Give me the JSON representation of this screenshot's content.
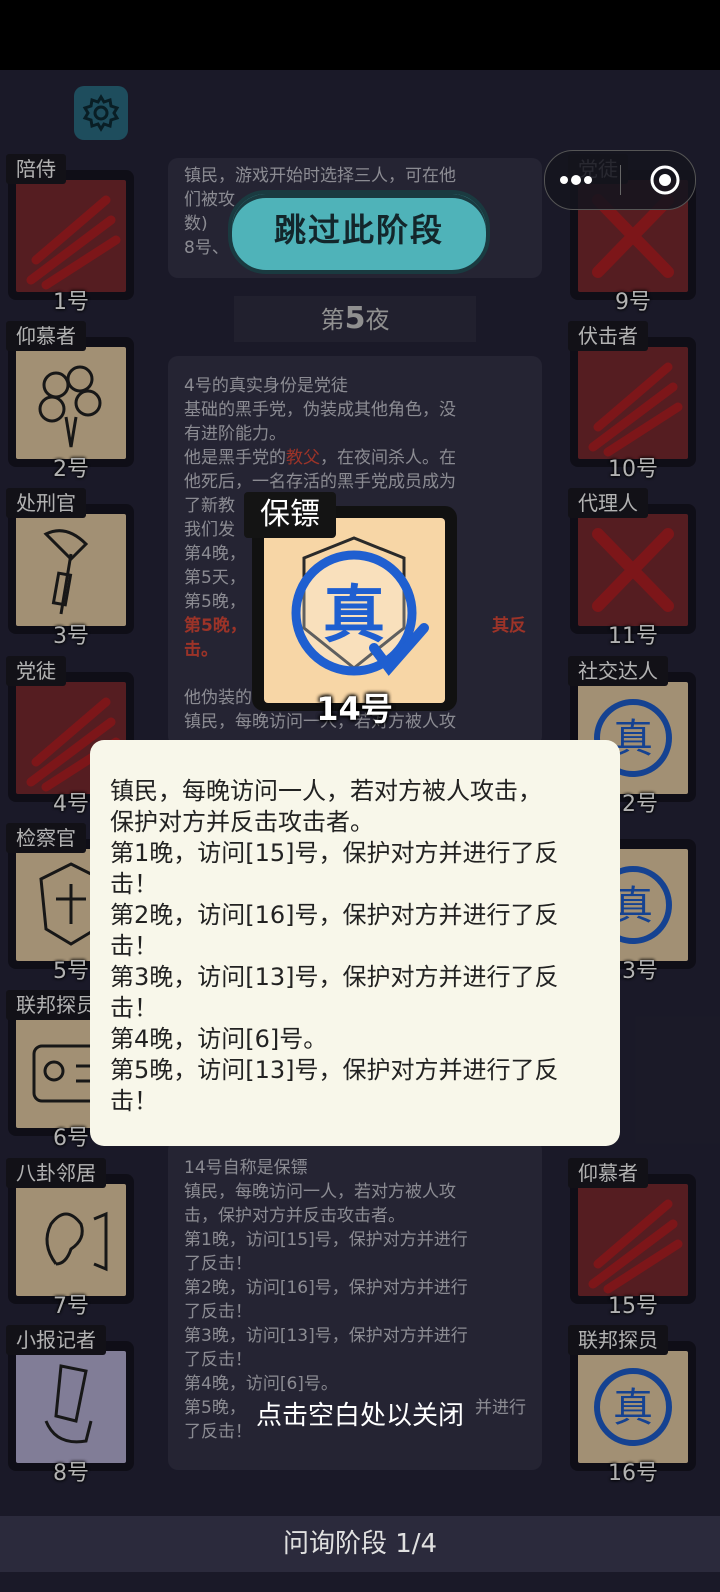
{
  "left_cards": [
    {
      "tag": "陪侍",
      "num": "1号",
      "dead": true
    },
    {
      "tag": "仰慕者",
      "num": "2号",
      "dead": false
    },
    {
      "tag": "处刑官",
      "num": "3号",
      "dead": false
    },
    {
      "tag": "党徒",
      "num": "4号",
      "dead": true
    },
    {
      "tag": "检察官",
      "num": "5号",
      "dead": false
    },
    {
      "tag": "联邦探员",
      "num": "6号",
      "dead": false
    },
    {
      "tag": "八卦邻居",
      "num": "7号",
      "dead": false
    },
    {
      "tag": "小报记者",
      "num": "8号",
      "dead": false
    }
  ],
  "right_cards": [
    {
      "tag": "党徒",
      "num": "9号",
      "dead": true
    },
    {
      "tag": "伏击者",
      "num": "10号",
      "dead": true
    },
    {
      "tag": "代理人",
      "num": "11号",
      "dead": true
    },
    {
      "tag": "社交达人",
      "num": "12号",
      "dead": false
    },
    {
      "tag": "者",
      "num": "13号",
      "dead": false
    },
    {
      "tag": "",
      "num": "",
      "dead": false
    },
    {
      "tag": "仰慕者",
      "num": "15号",
      "dead": true
    },
    {
      "tag": "联邦探员",
      "num": "16号",
      "dead": false
    }
  ],
  "skip_label": "跳过此阶段",
  "night_prefix": "第",
  "night_number": "5",
  "night_suffix": "夜",
  "top_text": [
    "镇民，游戏开始时选择三人，可在他",
    "们被攻",
    "数)",
    "8号、"
  ],
  "middle_text": {
    "l1": "4号的真实身份是党徒",
    "l2": "基础的黑手党，伪装成其他角色，没",
    "l3": "有进阶能力。",
    "l4a": "他是黑手党的",
    "l4b": "教父",
    "l4c": "，在夜间杀人。在",
    "l5": "他死后，一名存活的黑手党成员成为",
    "l6": "了新教",
    "l7": "我们发",
    "l8": "第4晚，",
    "l9": "第5天，",
    "l10": "第5晚，",
    "l11a": "第5晚，",
    "l11b": "其反",
    "l12": "击。",
    "l13": "他伪装的",
    "l14": "镇民，每晚访问一人，若对方被人攻"
  },
  "lower_text": [
    "14号自称是保镖",
    "镇民，每晚访问一人，若对方被人攻",
    "击，保护对方并反击攻击者。",
    "第1晚，访问[15]号，保护对方并进行",
    "了反击！",
    "第2晚，访问[16]号，保护对方并进行",
    "了反击！",
    "第3晚，访问[13]号，保护对方并进行",
    "了反击！",
    "第4晚，访问[6]号。",
    "第5晚，",
    "了反击！"
  ],
  "lower_text_tail": "并进行",
  "big_card": {
    "tag": "保镖",
    "num": "14号",
    "seal": "真"
  },
  "popup_lines": [
    "镇民，每晚访问一人，若对方被人攻击，",
    "保护对方并反击攻击者。",
    "第1晚，访问[15]号，保护对方并进行了反",
    "击！",
    "第2晚，访问[16]号，保护对方并进行了反",
    "击！",
    "第3晚，访问[13]号，保护对方并进行了反",
    "击！",
    "第4晚，访问[6]号。",
    "第5晚，访问[13]号，保护对方并进行了反",
    "击！"
  ],
  "close_hint": "点击空白处以关闭",
  "bottom_bar": "问询阶段 1/4",
  "seal_text": "真",
  "colors": {
    "accent_teal": "#4fb3b9",
    "dead_red": "#7a2a30",
    "blood": "#b32025",
    "seal_blue": "#1f5fd0",
    "popup_bg": "#f8f7ea"
  }
}
